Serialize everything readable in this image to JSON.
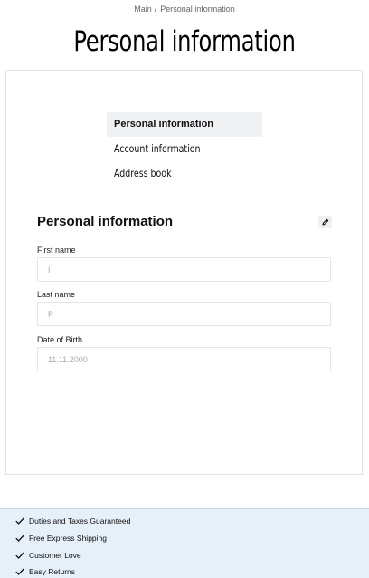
{
  "breadcrumb": {
    "home": "Main",
    "separator": "/",
    "current": "Personal information"
  },
  "page": {
    "title": "Personal information"
  },
  "side_nav": {
    "items": [
      {
        "label": "Personal information",
        "active": true
      },
      {
        "label": "Account information",
        "active": false
      },
      {
        "label": "Address book",
        "active": false
      }
    ]
  },
  "section": {
    "title": "Personal information",
    "edit_icon": "pencil-icon"
  },
  "form": {
    "first_name": {
      "label": "First name",
      "value": "I"
    },
    "last_name": {
      "label": "Last name",
      "value": "P"
    },
    "dob": {
      "label": "Date of Birth",
      "value": "11.11.2000"
    }
  },
  "perks": {
    "icon": "check-icon",
    "items": [
      "Duties and Taxes Guaranteed",
      "Free Express Shipping",
      "Customer Love",
      "Easy Returns"
    ]
  },
  "colors": {
    "perks_background": "#e6f0f9",
    "active_nav_background": "#f0f1f3",
    "border": "#e4e4e4"
  }
}
